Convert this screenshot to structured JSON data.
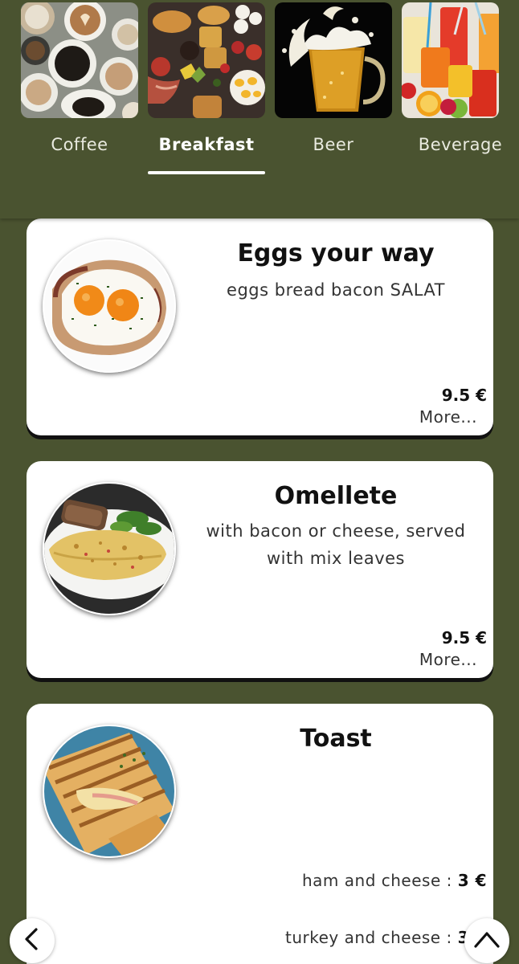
{
  "categories": [
    {
      "label": "Coffee",
      "active": false
    },
    {
      "label": "Breakfast",
      "active": true
    },
    {
      "label": "Beer",
      "active": false
    },
    {
      "label": "Beverage",
      "active": false
    }
  ],
  "items": [
    {
      "title": "Eggs your way",
      "description": "eggs bread bacon SALAT",
      "price": "9.5 €",
      "more": "More..."
    },
    {
      "title": "Omellete",
      "description_line1": "with bacon or cheese, served",
      "description_line2": "with mix leaves",
      "price": "9.5 €",
      "more": "More..."
    },
    {
      "title": "Toast",
      "variants": [
        {
          "name": "ham and cheese",
          "sep": " : ",
          "price": "3 €"
        },
        {
          "name": "turkey and cheese",
          "sep": " : ",
          "price": "3"
        }
      ]
    }
  ],
  "icons": {
    "back": "chevron-left-icon",
    "top": "chevron-up-icon"
  },
  "colors": {
    "background": "#4a5330",
    "card": "#ffffff"
  }
}
